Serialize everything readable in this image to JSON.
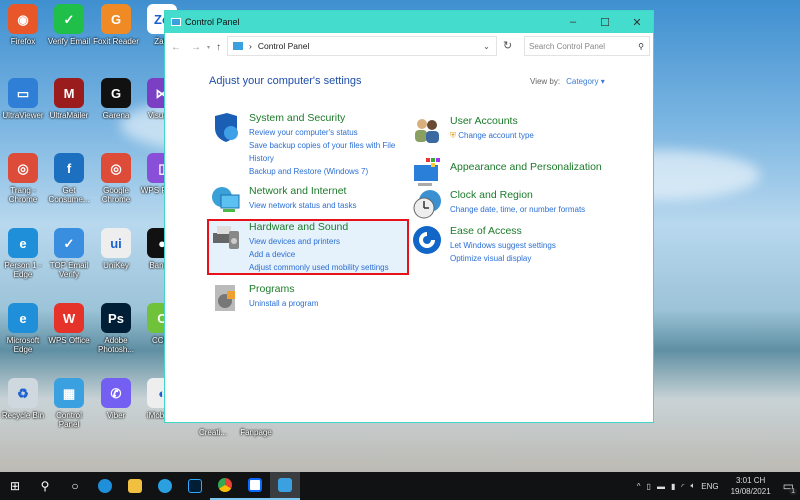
{
  "desktop": {
    "icons": [
      {
        "label": "Firefox",
        "color": "#e8572a",
        "glyph": "◉"
      },
      {
        "label": "Verify Email",
        "color": "#1fbf4a",
        "glyph": "✓"
      },
      {
        "label": "Foxit Reader",
        "color": "#f08a24",
        "glyph": "G"
      },
      {
        "label": "Zalo",
        "color": "#fff",
        "glyph": "Zo"
      },
      {
        "label": "UltraViewer",
        "color": "#2f7fd6",
        "glyph": "▭"
      },
      {
        "label": "UltraMailer",
        "color": "#9b1c1c",
        "glyph": "M"
      },
      {
        "label": "Garena",
        "color": "#111",
        "glyph": "G"
      },
      {
        "label": "Visual...",
        "color": "#7b3fc4",
        "glyph": "⋈"
      },
      {
        "label": "Trang - Chrome",
        "color": "#dd4b39",
        "glyph": "◎"
      },
      {
        "label": "Get Consume...",
        "color": "#1d6fc0",
        "glyph": "f"
      },
      {
        "label": "Google Chrome",
        "color": "#dd4b39",
        "glyph": "◎"
      },
      {
        "label": "WPS PDF...",
        "color": "#8a4fd8",
        "glyph": "▯"
      },
      {
        "label": "Person 1 - Edge",
        "color": "#1e8fd8",
        "glyph": "e"
      },
      {
        "label": "TOP Email Verify",
        "color": "#3a8ee0",
        "glyph": "✓"
      },
      {
        "label": "UniKey",
        "color": "#eee",
        "glyph": "ui"
      },
      {
        "label": "Band...",
        "color": "#111",
        "glyph": "●"
      },
      {
        "label": "Microsoft Edge",
        "color": "#1e8fd8",
        "glyph": "e"
      },
      {
        "label": "WPS Office",
        "color": "#e6332a",
        "glyph": "W"
      },
      {
        "label": "Adobe Photosh...",
        "color": "#001e36",
        "glyph": "Ps"
      },
      {
        "label": "CCl...",
        "color": "#6fc23a",
        "glyph": "C"
      },
      {
        "label": "Recycle Bin",
        "color": "#cfd8de",
        "glyph": "♻"
      },
      {
        "label": "Control Panel",
        "color": "#3aa0e0",
        "glyph": "▦"
      },
      {
        "label": "Viber",
        "color": "#7360f2",
        "glyph": "✆"
      },
      {
        "label": "iMobie...",
        "color": "#eee",
        "glyph": "◐"
      }
    ],
    "below_window": [
      "Creati...",
      "Fanpage"
    ]
  },
  "window": {
    "title": "Control Panel",
    "address": "Control Panel",
    "search_placeholder": "Search Control Panel",
    "heading": "Adjust your computer's settings",
    "view_by_label": "View by:",
    "view_by_value": "Category",
    "categories_left": [
      {
        "title": "System and Security",
        "links": [
          "Review your computer's status",
          "Save backup copies of your files with File",
          "History",
          "Backup and Restore (Windows 7)"
        ]
      },
      {
        "title": "Network and Internet",
        "links": [
          "View network status and tasks"
        ]
      },
      {
        "title": "Hardware and Sound",
        "links": [
          "View devices and printers",
          "Add a device",
          "Adjust commonly used mobility settings"
        ]
      },
      {
        "title": "Programs",
        "links": [
          "Uninstall a program"
        ]
      }
    ],
    "categories_right": [
      {
        "title": "User Accounts",
        "links": [
          "Change account type"
        ]
      },
      {
        "title": "Appearance and Personalization",
        "links": []
      },
      {
        "title": "Clock and Region",
        "links": [
          "Change date, time, or number formats"
        ]
      },
      {
        "title": "Ease of Access",
        "links": [
          "Let Windows suggest settings",
          "Optimize visual display"
        ]
      }
    ]
  },
  "taskbar": {
    "language": "ENG",
    "time": "3:01 CH",
    "date": "19/08/2021",
    "notifications": "1"
  }
}
